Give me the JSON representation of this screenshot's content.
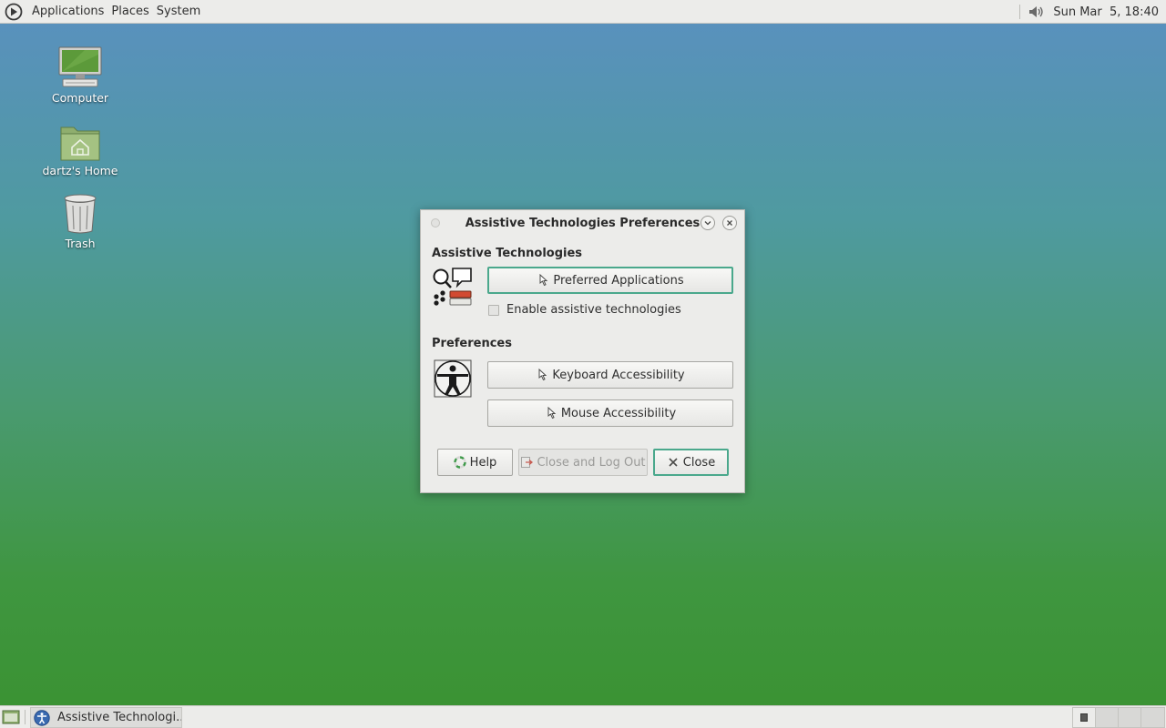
{
  "top_panel": {
    "menus": [
      "Applications",
      "Places",
      "System"
    ],
    "clock": "Sun Mar  5, 18:40",
    "logo_icon": "distro-logo-icon",
    "tray_icon": "volume-icon"
  },
  "desktop": {
    "icons": [
      {
        "label": "Computer",
        "icon": "computer-icon"
      },
      {
        "label": "dartz's Home",
        "icon": "home-folder-icon"
      },
      {
        "label": "Trash",
        "icon": "trash-icon"
      }
    ]
  },
  "dialog": {
    "title": "Assistive Technologies Preferences",
    "section_assistive": "Assistive Technologies",
    "preferred_apps_label": "Preferred Applications",
    "enable_checkbox_label": "Enable assistive technologies",
    "enable_checked": false,
    "section_preferences": "Preferences",
    "keyboard_label": "Keyboard Accessibility",
    "mouse_label": "Mouse Accessibility",
    "help_label": "Help",
    "logout_label": "Close and Log Out",
    "close_label": "Close"
  },
  "taskbar": {
    "task_label": "Assistive Technologi...",
    "workspaces": 4,
    "active_workspace": 1
  },
  "colors": {
    "panel": "#ececea",
    "focus_accent": "#4aa88c",
    "desktop_top": "#5a90c0",
    "desktop_bottom": "#3a9231"
  }
}
